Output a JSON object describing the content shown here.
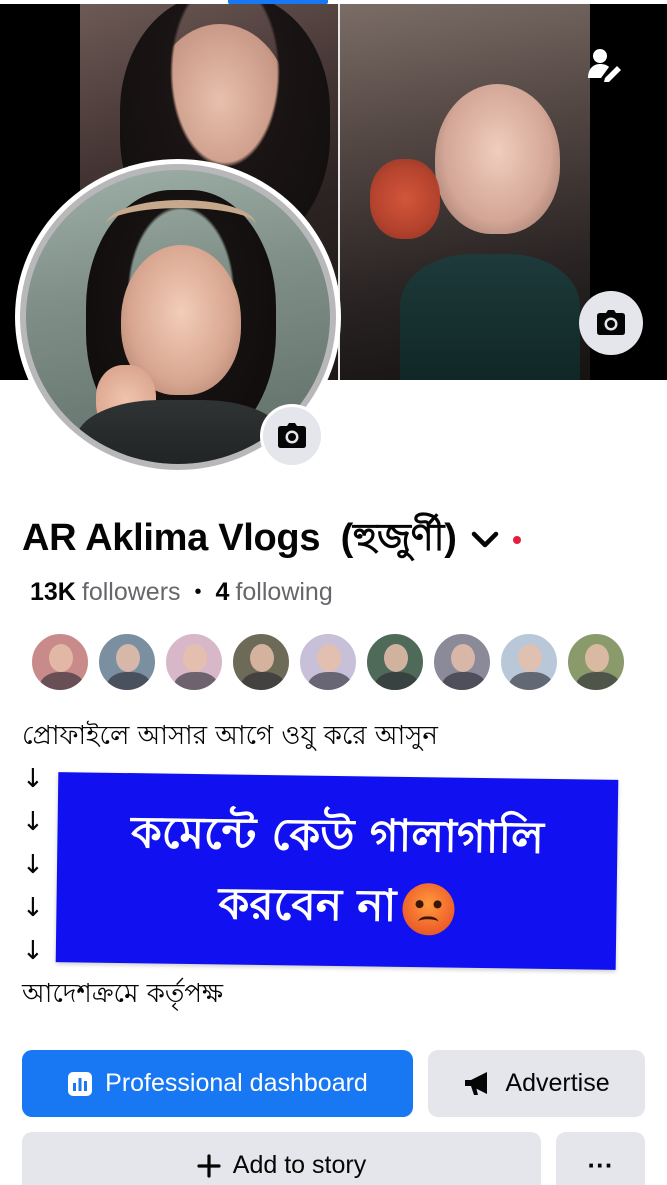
{
  "profile": {
    "name": "AR Aklima Vlogs  (হুজুর্ণী)",
    "followers_count": "13K",
    "followers_label": "followers",
    "separator": "•",
    "following_count": "4",
    "following_label": "following"
  },
  "bio": {
    "lines": [
      "প্রোফাইলে আসার আগে ওযু করে আসুন",
      "↓",
      "↓",
      "↓",
      "↓",
      "↓",
      "আদেশক্রমে কর্তৃপক্ষ"
    ]
  },
  "banner": {
    "line1": "কমেন্টে কেউ গালাগালি",
    "line2": "করবেন না",
    "emoji": "angry-face",
    "color": "#1010f0"
  },
  "friends": {
    "colors": [
      "#c98a8a",
      "#7a8fa0",
      "#d8b8c8",
      "#6d6a58",
      "#c8c0d8",
      "#4f6a58",
      "#8a8a98",
      "#b8c8d8",
      "#8a9a6a"
    ]
  },
  "actions": {
    "professional_dashboard": "Professional dashboard",
    "advertise": "Advertise",
    "add_to_story": "Add to story",
    "more": "···"
  },
  "colors": {
    "accent": "#1877f2",
    "secondary_button": "#e4e6eb",
    "status_dot": "#e41e3f"
  }
}
